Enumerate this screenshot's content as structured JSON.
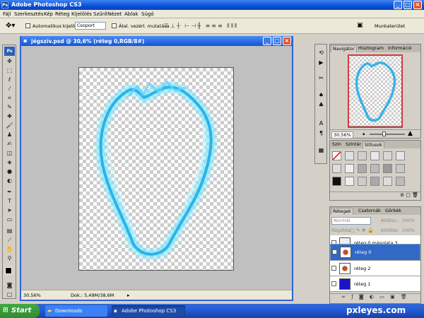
{
  "window": {
    "title": "Adobe Photoshop CS3"
  },
  "menu": [
    "Fájl",
    "Szerkesztés",
    "Kép",
    "Réteg",
    "Kijelölés",
    "Szűrő",
    "Nézet",
    "Ablak",
    "Súgó"
  ],
  "options": {
    "auto_select_label": "Automatikus kijelölés:",
    "auto_select_value": "Csoport",
    "transform_label": "Átal. vezérl. mutatása",
    "workspace_label": "Munkaterület"
  },
  "document": {
    "title": "jégszív.psd @ 30,6% (réteg 0,RGB/8#)",
    "zoom": "30,56%",
    "doc_info": "Dok.: 5,49M/38,6M"
  },
  "navigator": {
    "tabs": [
      "Navigátor",
      "Hisztogram",
      "Információ"
    ],
    "zoom": "30,56%"
  },
  "color_panel": {
    "tabs": [
      "Szín",
      "Színtár",
      "Stílusok"
    ]
  },
  "layers_panel": {
    "tabs": [
      "Rétegek",
      "Csatornák",
      "Görbék"
    ],
    "blend_mode": "Normál",
    "opacity_label": "Átlátsz.:",
    "opacity_value": "100%",
    "lock_label": "Rögzítés:",
    "fill_label": "Kitöltés:",
    "fill_value": "100%",
    "layers": [
      {
        "name": "réteg 0 másolata 3"
      },
      {
        "name": "réteg 0"
      },
      {
        "name": "réteg 2"
      },
      {
        "name": "réteg 1"
      }
    ]
  },
  "taskbar": {
    "start": "Start",
    "items": [
      "Downloads",
      "Adobe Photoshop CS3"
    ]
  },
  "watermark": "pxleyes.com",
  "icons": {
    "move": "move-tool-icon",
    "lasso": "lasso-icon",
    "brush": "brush-icon"
  },
  "colors": {
    "accent": "#3169c6",
    "stroke": "#3ad0ff"
  }
}
